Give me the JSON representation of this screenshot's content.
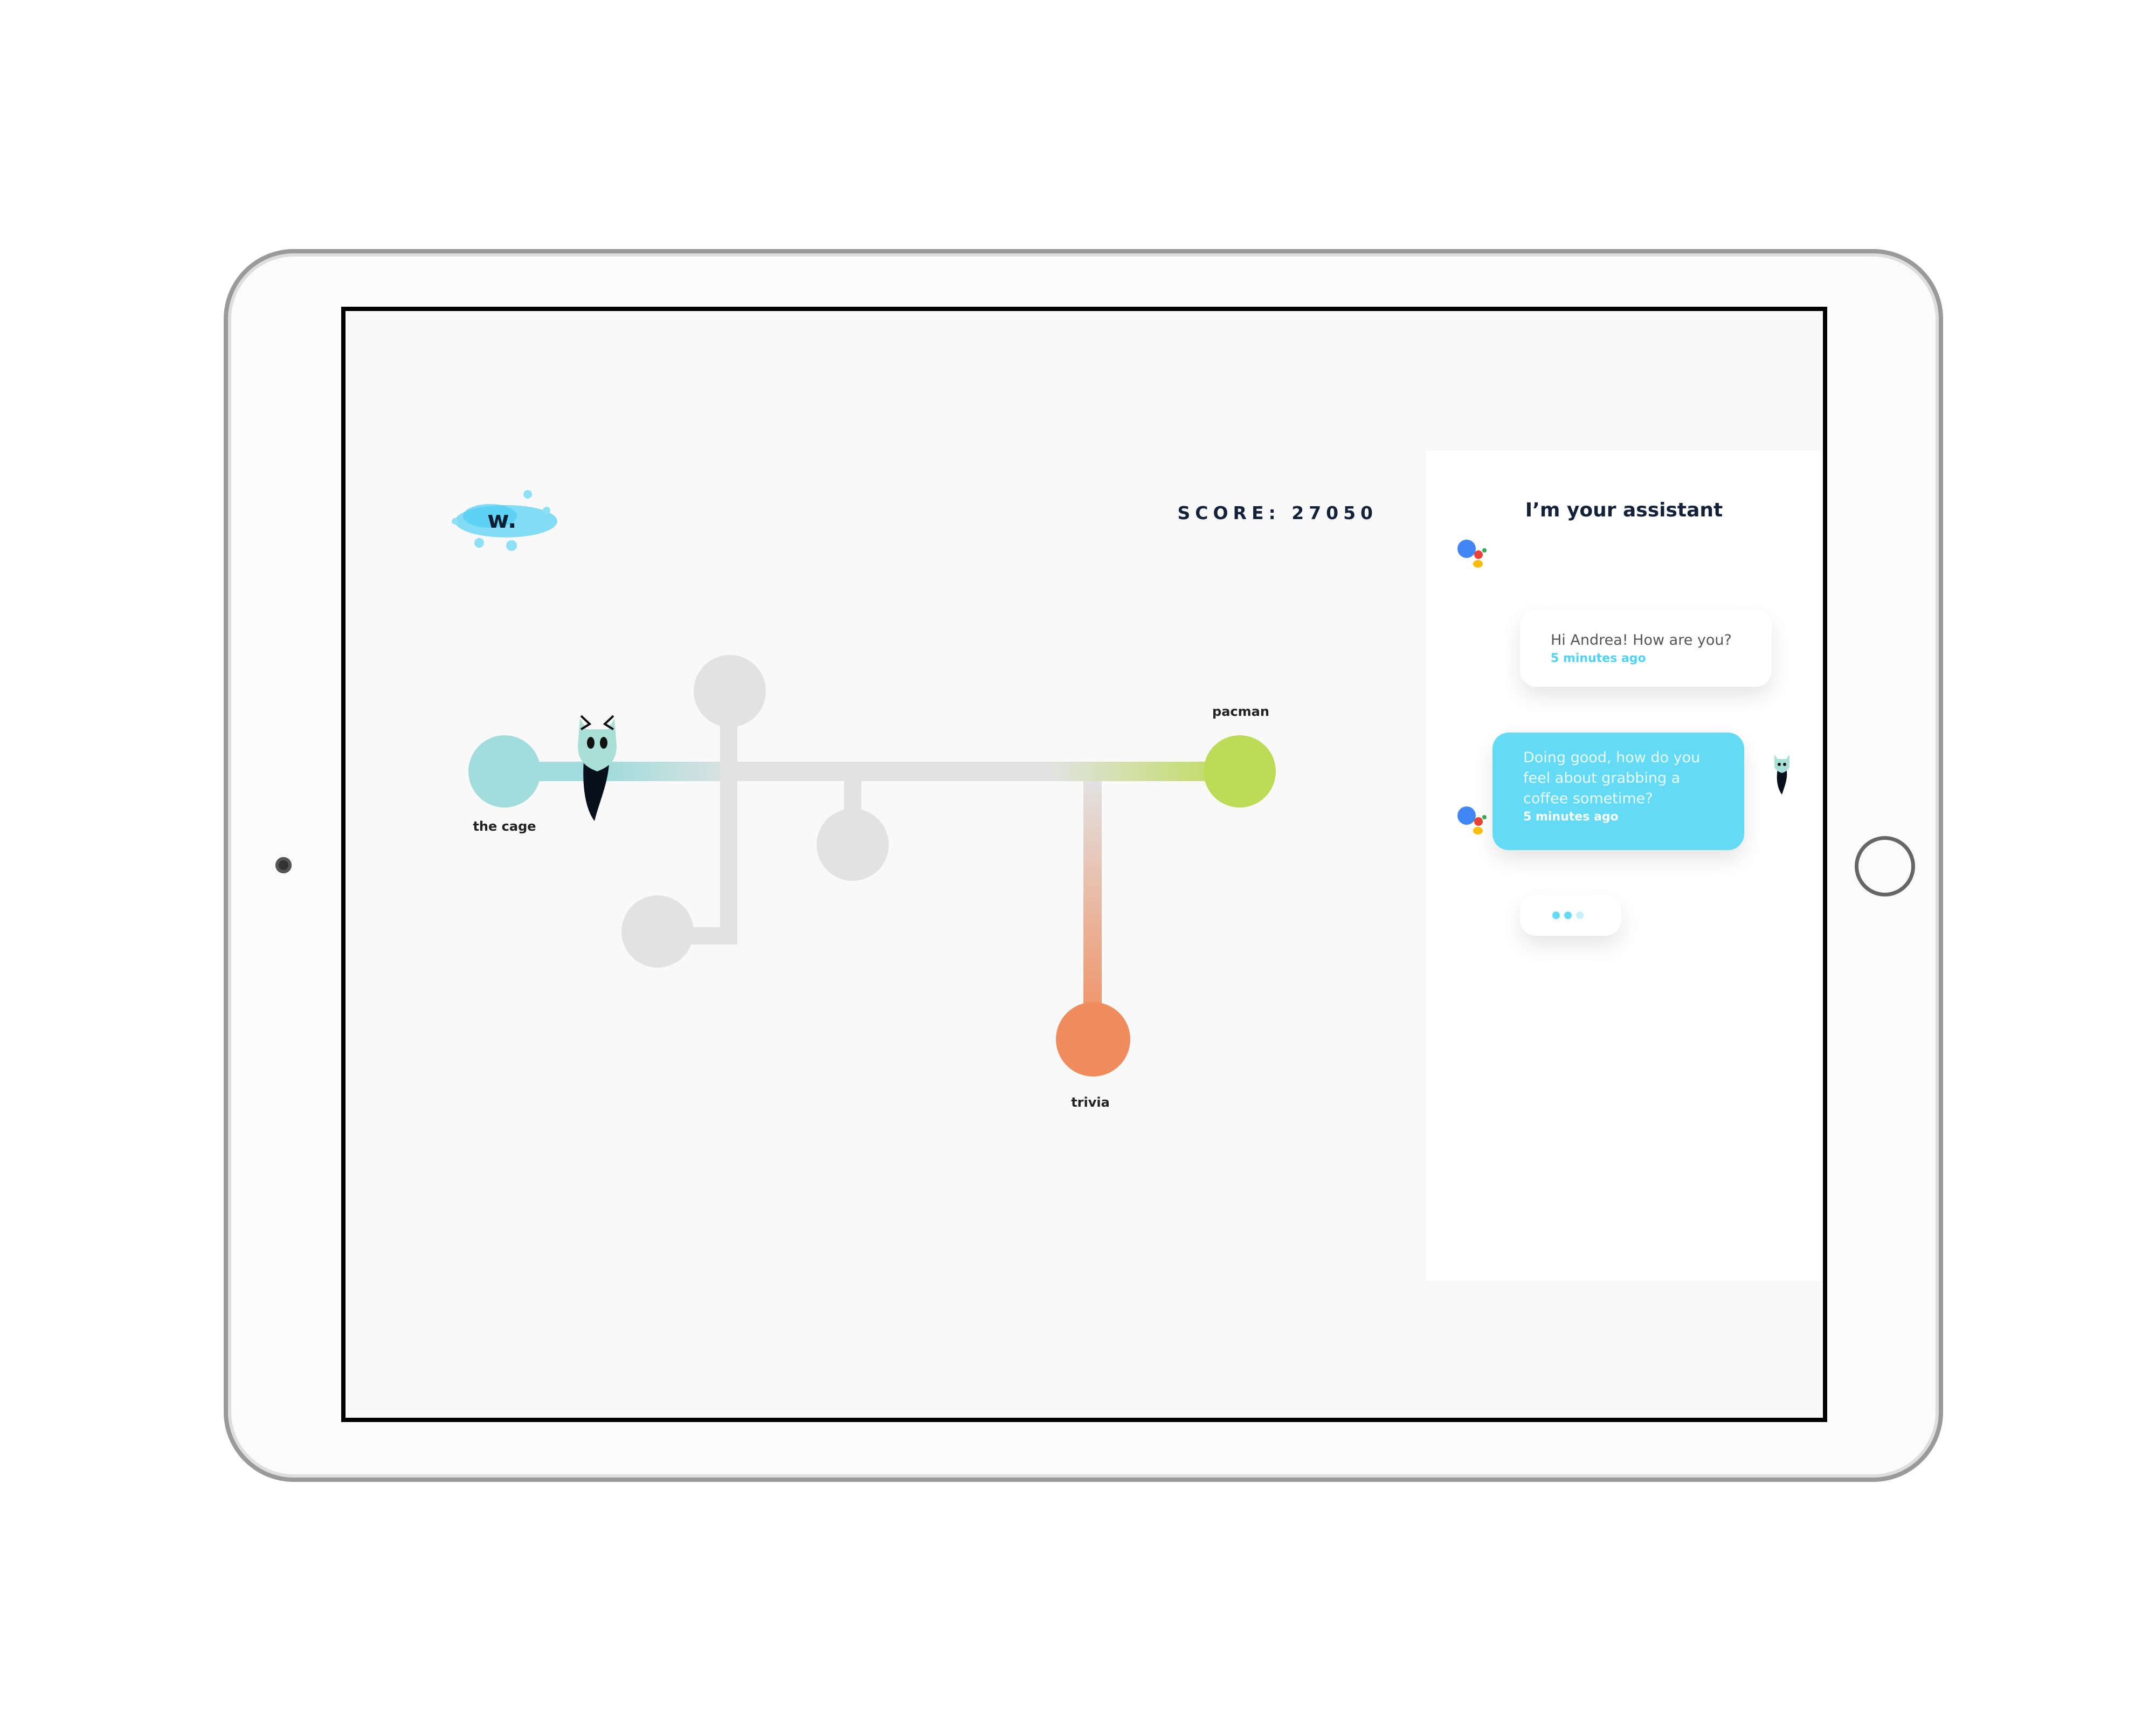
{
  "game": {
    "logo_text": "w.",
    "score_label": "SCORE: 27050",
    "nodes": [
      {
        "label": "the cage",
        "color": "#a3dcdc"
      },
      {
        "label": "pacman",
        "color": "#bcdc55"
      },
      {
        "label": "trivia",
        "color": "#f08c5c"
      }
    ],
    "locked_color": "#e2e2e2"
  },
  "assistant": {
    "title": "I’m your assistant",
    "messages": [
      {
        "sender": "assistant",
        "text": "Hi Andrea! How are you?",
        "time": "5 minutes ago"
      },
      {
        "sender": "user",
        "text": "Doing good, how do you feel about grabbing a coffee sometime?",
        "time": "5 minutes ago"
      },
      {
        "sender": "assistant",
        "typing": true
      }
    ],
    "accent": "#63dbf7"
  }
}
